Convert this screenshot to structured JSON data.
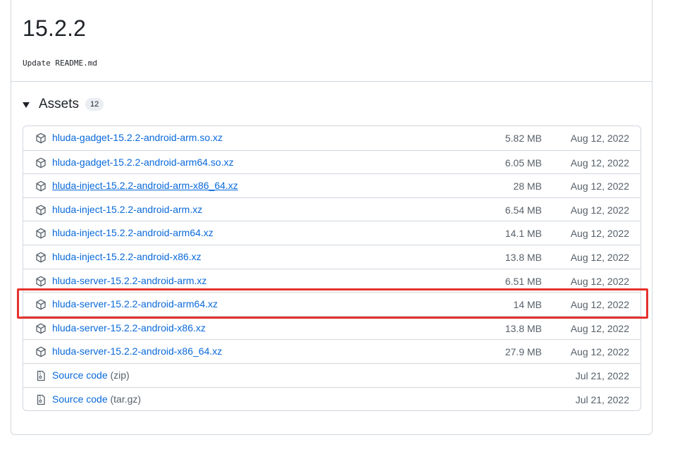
{
  "release": {
    "title": "15.2.2",
    "body": "Update README.md"
  },
  "assets": {
    "label": "Assets",
    "count": "12",
    "items": [
      {
        "name": "hluda-gadget-15.2.2-android-arm.so.xz",
        "size": "5.82 MB",
        "date": "Aug 12, 2022",
        "icon": "package-icon"
      },
      {
        "name": "hluda-gadget-15.2.2-android-arm64.so.xz",
        "size": "6.05 MB",
        "date": "Aug 12, 2022",
        "icon": "package-icon"
      },
      {
        "name": "hluda-inject-15.2.2-android-arm-x86_64.xz",
        "size": "28 MB",
        "date": "Aug 12, 2022",
        "icon": "package-icon"
      },
      {
        "name": "hluda-inject-15.2.2-android-arm.xz",
        "size": "6.54 MB",
        "date": "Aug 12, 2022",
        "icon": "package-icon"
      },
      {
        "name": "hluda-inject-15.2.2-android-arm64.xz",
        "size": "14.1 MB",
        "date": "Aug 12, 2022",
        "icon": "package-icon"
      },
      {
        "name": "hluda-inject-15.2.2-android-x86.xz",
        "size": "13.8 MB",
        "date": "Aug 12, 2022",
        "icon": "package-icon"
      },
      {
        "name": "hluda-server-15.2.2-android-arm.xz",
        "size": "6.51 MB",
        "date": "Aug 12, 2022",
        "icon": "package-icon"
      },
      {
        "name": "hluda-server-15.2.2-android-arm64.xz",
        "size": "14 MB",
        "date": "Aug 12, 2022",
        "icon": "package-icon"
      },
      {
        "name": "hluda-server-15.2.2-android-x86.xz",
        "size": "13.8 MB",
        "date": "Aug 12, 2022",
        "icon": "package-icon"
      },
      {
        "name": "hluda-server-15.2.2-android-x86_64.xz",
        "size": "27.9 MB",
        "date": "Aug 12, 2022",
        "icon": "package-icon"
      },
      {
        "name": "Source code",
        "suffix": "(zip)",
        "size": "",
        "date": "Jul 21, 2022",
        "icon": "file-zip-icon"
      },
      {
        "name": "Source code",
        "suffix": "(tar.gz)",
        "size": "",
        "date": "Jul 21, 2022",
        "icon": "file-zip-icon"
      }
    ]
  },
  "colors": {
    "link": "#0969da",
    "muted": "#57606a",
    "border": "#d0d7de",
    "highlight": "#e5322d"
  }
}
